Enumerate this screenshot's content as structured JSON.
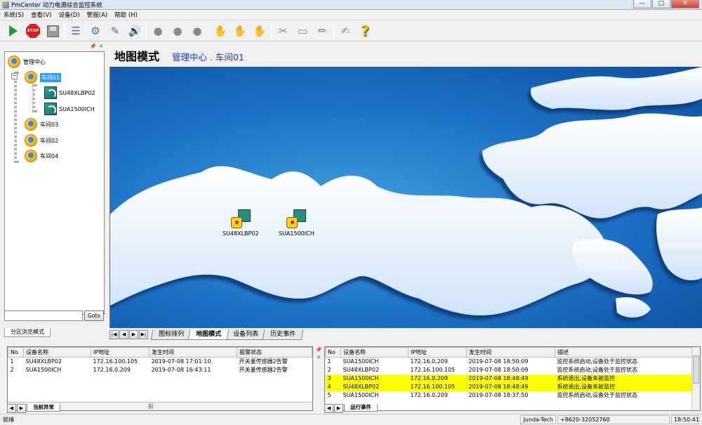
{
  "window": {
    "title": "PmCenter 动力电源综合监控系统",
    "min_icon": "—",
    "max_icon": "□",
    "close_icon": "✕"
  },
  "menu": [
    "系统(S)",
    "查看(V)",
    "设备(D)",
    "警报(A)",
    "帮助 (H)"
  ],
  "toolbar": {
    "stop_label": "STOP",
    "help_glyph": "?"
  },
  "sidebar": {
    "pin_icon": "📌",
    "close_icon": "✕",
    "tree": {
      "root": "管理中心",
      "workshop01": "车间01",
      "expander": "−",
      "devices": [
        "SU48XLBP02",
        "SUA1500ICH"
      ],
      "workshop03": "车间03",
      "workshop02": "车间02",
      "workshop04": "车间04"
    },
    "goto_label": "Goto",
    "goto_value": "",
    "tab_label": "分区浏览模式"
  },
  "map": {
    "title": "地图模式",
    "breadcrumb": "管理中心 . 车间01",
    "devices": [
      {
        "name": "SU48XLBP02"
      },
      {
        "name": "SUA1500ICH"
      }
    ],
    "tabs": [
      "图标排列",
      "地图模式",
      "设备列表",
      "历史事件"
    ],
    "active_tab": "地图模式",
    "nav": [
      "|◀",
      "◀",
      "▶",
      "▶|"
    ]
  },
  "alarm_panel": {
    "columns": [
      "No",
      "设备名称",
      "IP地址",
      "发生时间",
      "报警状态"
    ],
    "rows": [
      [
        "1",
        "SU48XLBP02",
        "172.16.100.105",
        "2019-07-08 17:01:10",
        "开关量传感器2告警"
      ],
      [
        "2",
        "SUA1500ICH",
        "172.16.0.209",
        "2019-07-08 16:43:11",
        "开关量传感器2告警"
      ]
    ],
    "scroll_mark": "|||",
    "tab_label": "当前异常"
  },
  "event_panel": {
    "columns": [
      "No",
      "设备名称",
      "IP地址",
      "发生时间",
      "描述"
    ],
    "rows": [
      [
        "1",
        "SUA1500ICH",
        "172.16.0.209",
        "2019-07-08 18:50:09",
        "监控系统启动,设备处于监控状态"
      ],
      [
        "2",
        "SU48XLBP02",
        "172.16.100.105",
        "2019-07-08 18:50:09",
        "监控系统启动,设备处于监控状态"
      ],
      [
        "3",
        "SUA1500ICH",
        "172.16.0.209",
        "2019-07-08 18:48:49",
        "系统退出,设备未被监控"
      ],
      [
        "4",
        "SU48XLBP02",
        "172.16.100.105",
        "2019-07-08 18:48:49",
        "系统退出,设备未被监控"
      ],
      [
        "5",
        "SUA1500ICH",
        "172.16.0.209",
        "2019-07-08 18:37:50",
        "监控系统启动,设备处于监控状态"
      ]
    ],
    "highlighted_rows": [
      2,
      3
    ],
    "highlight_color": "#ffff00",
    "tab_label": "运行事件"
  },
  "statusbar": {
    "ready": "就绪",
    "company": "Junda-Tech",
    "phone": "+8620-32052760",
    "time": "18:50:41"
  }
}
